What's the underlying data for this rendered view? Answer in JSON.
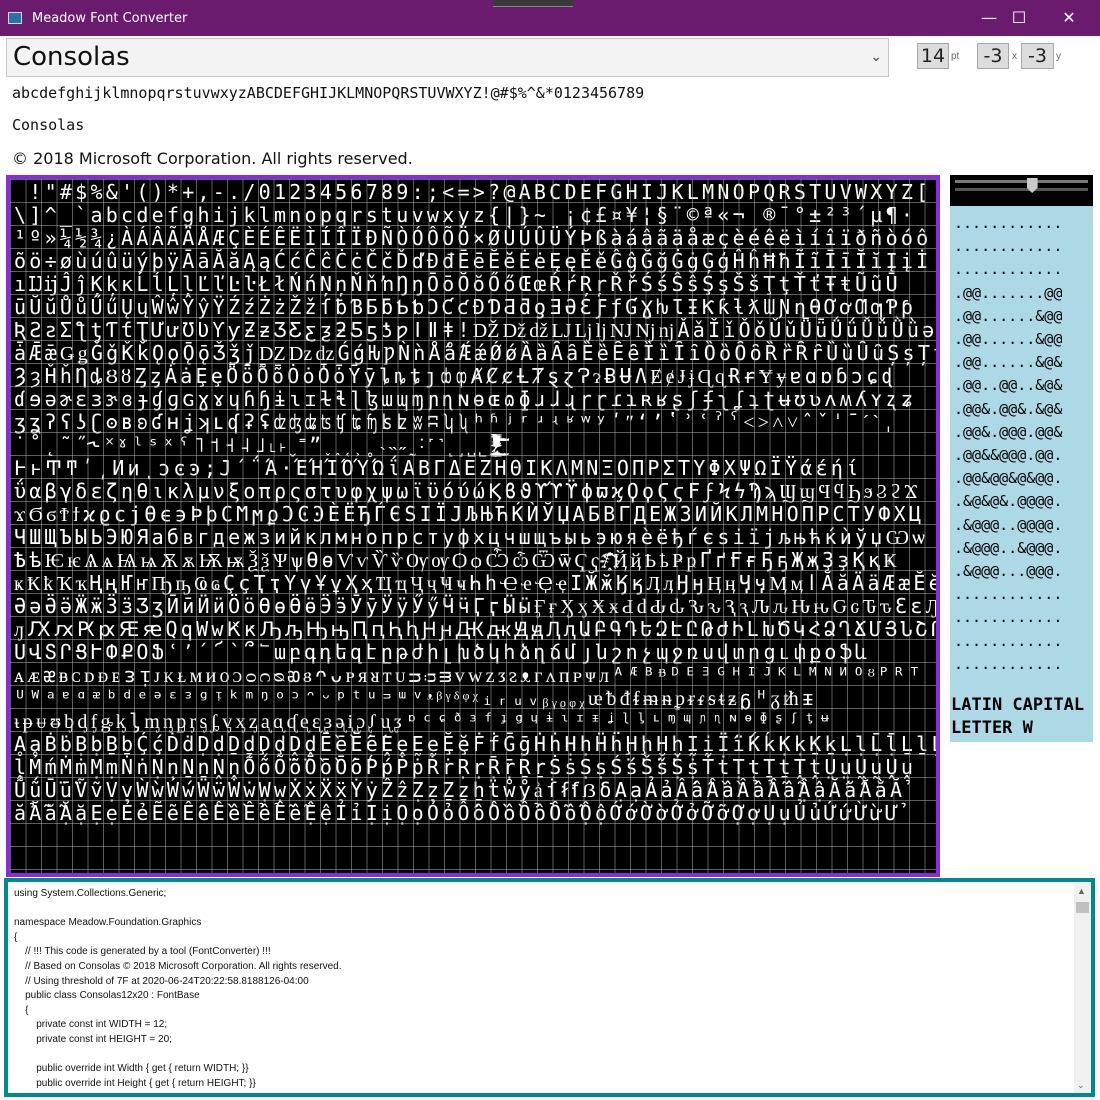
{
  "window": {
    "title": "Meadow Font Converter",
    "minimize_glyph": "—",
    "maximize_glyph": "☐",
    "close_glyph": "✕",
    "titlebar_color": "#6b1b6e"
  },
  "toolbar": {
    "font_selected": "Consolas",
    "chevron_glyph": "⌄",
    "size_value": "14",
    "size_unit": "pt",
    "x_offset_value": "-3",
    "x_unit": "x",
    "y_offset_value": "-3",
    "y_unit": "y"
  },
  "preview": {
    "sample_chars": "abcdefghijklmnopqrstuvwxyzABCDEFGHIJKLMNOPQRSTUVWXYZ!@#$%^&*0123456789",
    "font_name": "Consolas",
    "copyright": "© 2018 Microsoft Corporation. All rights reserved."
  },
  "glyph_grid": {
    "border_color": "#8a2be2",
    "text": " !\"#$%&'()*+,-./0123456789:;<=>?@ABCDEFGHIJKLMNOPQRSTUVWXYZ[\n\\]^_`abcdefghijklmnopqrstuvwxyz{|}~ ¡¢£¤¥¦§¨©ª«¬ ®¯°±²³´µ¶·\n¹º»¼½¾¿ÀÁÂÃÄÅÆÇÈÉÊËÌÍÎÏÐÑÒÓÔÕÖ×ØÙÚÛÜÝÞßàáâãäåæçèéêëìíîïðñòóô\nõö÷øùúûüýþÿĀāĂăĄąĆćĈĉĊċČčĎďĐđĒēĔĕĖėĘęĚěĜĝĞğĠġĢģĤĥĦħĨĩĪīĬĭĮįİ\nıĲĳĴĵĶķĸĹĺĻļĽľĿŀŁłŃńŅņŇňŉŊŋŌōŎŏŐőŒœŔŕŖŗŘřŚśŜŝŞşŠšŢţŤťŦŧŨũŪ\nūŬŭŮůŰűŲųŴŵŶŷŸŹźŻżŽžſƀƁƂƃƄƅƆƇƈƉƊƋƌƍƎƏƐƑƒƓƔƕƖƗƘƙƚƛƜƝƞƟƠơƢƣƤƥ\nƦƧƨƩƪƫƬƭƮƯưƱƲƳƴƵƶƷƸƹƺƻƼƽƾƿǀǁǂǃǄǅǆǇǈǉǊǋǌǍǎǏǐǑǒǓǔǕǖǗǘǙǚǛǜǝǞǟǠ\nǡǢǣǤǥǦǧǨǩǪǫǬǭǮǯǰǱǲǳǴǵǶǷǸǹǺǻǼǽǾǿȀȁȂȃȄȅȆȇȈȉȊȋȌȍȎȏȐȑȒȓȔȕȖȗȘșȚț\nȜȝȞȟȠȡȢȣȤȥȦȧȨȩȪȫȬȭȮȯȰȱȲȳȴȵȶȷȸȹȺȻȼȽȾȿɀɁɂɃɄɅɆɇɈɉɊɋɌɍɎɏɐɑɒɓɔɕɖ\nɗɘəɚɛɜɝɞɟɠɡɢɣɤɥɦɧɨɩɪɫɬɭɮɯɰɱɲɳɴɵɶɷɸɹɺɻɼɽɾɿʀʁʂʃʄʅʆʇʈʉʊʋʌʍʎʏʐʑ\nʒʓʔʕʖʗʘʙʚʛʜʝʞʟʠʡʢʣʤʥʦʧʨʩʪʫʬʭʮʯʰʱʲʳʴʵʶʷʸʹʺʻʼʽʾʿˀˁ˂˃˄˅ˆˇˈˉˊˋˌ\n˙˚˛˜˝˞˟ˠˡˢˣˤ˥˦˧˨˩˪˫ˬ˭ˮ˯˰˱˲˳˴˵˶˷˸˹˺˻˼˽˾˿̴̵̶̷̸̡̢̧̨̛̖̗̘̙̜̝̞̟̠̣̤̥̦̩̪̫̬̭̮̯̰̱̲̳̹̺̻̼͇͈͉͍͎̀́̂̃̄̅̆̇̈̉̊̋̌̍̎̏̐̑̒̓̔̽̾̿̀́͂̓̈́͆͊͋͌̕̚ͅ͏͓͔͕͖͙͚͐͑͒͗͛ͣͤͥͦͧͨͩͪͫͬͭͮͯ͘͜͟͢͝͞͠͡\nͰͱͲͳʹ͵Ͷͷͺͻͼͽ;Ϳ΄΅Ά·ΈΉΊΌΎΏΐΑΒΓΔΕΖΗΘΙΚΛΜΝΞΟΠΡΣΤΥΦΧΨΩΪΫάέήί\nΰαβγδεζηθικλμνξοπρςστυφχψωϊϋόύώϏϐϑϒϓϔϕϖϗϘϙϚϛϜϝϞϟϠϡϢϣϤϥϦϧϨϩϪ\nϫϬϭϮϯϰϱϲϳϴϵ϶ϷϸϹϺϻϼϽϾϿЀЁЂЃЄЅІЇЈЉЊЋЌЍЎЏАБВГДЕЖЗИЙКЛМНОПРСТУФХЦ\nЧШЩЪЫЬЭЮЯабвгдежзийклмнопрстуфхцчшщъыьэюяѐёђѓєѕіїјљњћќѝўџѠѡ\nѢѣѤѥѦѧѨѩѪѫѬѭѮѯѰѱѲѳѴѵѶѷѸѹѺѻѼѽѾѿҀҁ҂҃҄҅҆҇҈҉ҊҋҌҍҎҏҐґҒғҔҕҖҗҘҙҚқҜ\nҝҞҟҠҡҢңҤҥҦҧҨҩҪҫҬҭҮүҰұҲҳҴҵҶҷҸҹҺһҼҽҾҿӀӁӂӃӄӅӆӇӈӉӊӋӌӍӎӏӐӑӒӓӔӕӖӗ\nӘәӚӛӜӝӞӟӠӡӢӣӤӥӦӧӨөӪӫӬӭӮӯӰӱӲӳӴӵӶӷӸӹӺӻӼӽӾӿԀԁԂԃԄԅԆԇԈԉԊԋԌԍԎԏԐԑԒ\nԓԔԕԖԗԘԙԚԛԜԝԞԟԠԡԢԣԤԥԦԧԨԩԪԫԬԭԮԯԱԲԳԴԵԶԷԸԹԺԻԼԽԾԿՀՁՂՃՄՅՆՇՈՉՊՋՌ\nՍՎՏՐՑՒՓՔՕՖՙ՚՛՜՝՞՟աբգդեզէըթժիլխծկհձղճմյնշոչպջռսվտրցւփքօֆև\nᴀᴁᴂᴃᴄᴅᴆᴇᴈᴉᴊᴋᴌᴍᴎᴏᴐᴑᴒᴓᴔᴕᴖᴗᴘᴙᴚᴛᴜᴝᴞᴟᴠᴡᴢᴣᴤᴥᴦᴧᴨᴩᴪᴫᴬᴭᴮᴯᴰᴱᴲᴳᴴᴵᴶᴷᴸᴹᴺᴻᴼᴽᴾᴿᵀ\nᵁᵂᵃᵄᵅᵆᵇᵈᵉᵊᵋᵌᵍᵎᵏᵐᵑᵒᵓᵔᵕᵖᵗᵘᵙᵚᵛᵜᵝᵞᵟᵠᵡᵢᵣᵤᵥᵦᵧᵨᵩᵪᵫᵬᵭᵮᵯᵰᵱᵲᵳᵴᵵᵶᵷᵸᵹᵺᵻ\nᵼᵽᵾᵿᶀᶁᶂᶃᶄᶅᶆᶇᶈᶉᶊᶋᶌᶍᶎᶏᶐᶑᶒᶓᶔᶕᶖᶗᶘᶙᶚᶛᶜᶝᶞᶟᶠᶡᶢᶣᶤᶥᶦᶧᶨᶩᶪᶫᶬᶭᶮᶯᶰᶱᶲᶳᶴᶵᶶ\nḀḁḂḃḄḅḆḇḈḉḊḋḌḍḎḏḐḑḒḓḔḕḖḗḘḙḚḛḜḝḞḟḠḡḢḣḤḥḦḧḨḩḪḫḬḭḮḯḰḱḲḳḴḵḶḷḸḹḺḻḼ\nḽḾḿṀṁṂṃṄṅṆṇṈṉṊṋṌṍṎṏṐṑṒṓṔṕṖṗṘṙṚṛṜṝṞṟṠṡṢṣṤṥṦṧṨṩṪṫṬṭṮṯṰṱṲṳṴṵṶṷ\nṸṹṺṻṼṽṾṿẀẁẂẃẄẅẆẇẈẉẊẋẌẍẎẏẐẑẒẓẔẕẖẗẘẙẚẛẜẝẞẟẠạẢảẤấẦầẨẩẪẫẬậẮắẰằẲ\nẳẴẵẶặẸẹẺẻẼẽẾếỀềỂểỄễỆệỈỉỊịỌọỎỏỐốỒồỔổỖỗỘộỚớỜờỞởỠỡỢợỤụỦủỨứỪừỬ"
  },
  "side_panel": {
    "background": "#add8e6",
    "slider_value": 0.58,
    "bitmap_rows": [
      "............",
      "............",
      "............",
      ".@@.......@@",
      ".@@......&@@",
      ".@@......&@@",
      ".@@......&@&",
      ".@@..@@..&@&",
      ".@@&.@@&.&@&",
      ".@@&.@@@.@@&",
      ".@@&&@@@.@@.",
      ".@@&@@&@&@@.",
      ".&@&@&.@@@@.",
      ".&@@@..@@@@.",
      ".&@@@..&@@@.",
      ".&@@@...@@@.",
      "............",
      "............",
      "............",
      "............"
    ],
    "char_name": "LATIN CAPITAL LETTER W"
  },
  "code": {
    "border_color": "#008b8b",
    "lines": [
      "using System.Collections.Generic;",
      "",
      "namespace Meadow.Foundation.Graphics",
      "{",
      "    // !!! This code is generated by a tool (FontConverter) !!!",
      "    // Based on Consolas © 2018 Microsoft Corporation. All rights reserved.",
      "    // Using threshold of 7F at 2020-06-24T20:22:58.8188126-04:00",
      "    public class Consolas12x20 : FontBase",
      "    {",
      "        private const int WIDTH = 12;",
      "        private const int HEIGHT = 20;",
      "",
      "        public override int Width { get { return WIDTH; }}",
      "        public override int Height { get { return HEIGHT; }}"
    ],
    "scroll_up_glyph": "▲",
    "scroll_down_glyph": "⌄"
  }
}
